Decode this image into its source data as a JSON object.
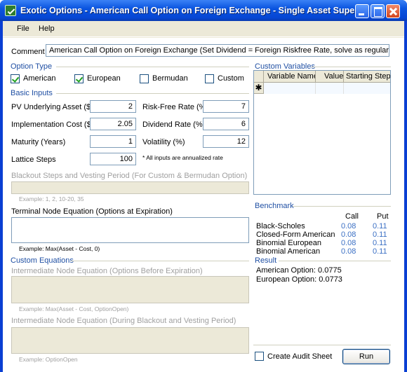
{
  "window": {
    "title": "Exotic Options - American Call Option on Foreign Exchange - Single Asset Super..."
  },
  "menu": {
    "file": "File",
    "help": "Help"
  },
  "comment": {
    "label": "Comment",
    "value": "American Call Option on Foreign Exchange (Set Dividend = Foreign Riskfree Rate, solve as regular options)"
  },
  "option_type": {
    "heading": "Option Type",
    "american": {
      "label": "American",
      "checked": true
    },
    "european": {
      "label": "European",
      "checked": true
    },
    "bermudan": {
      "label": "Bermudan",
      "checked": false
    },
    "custom": {
      "label": "Custom",
      "checked": false
    }
  },
  "basic_inputs": {
    "heading": "Basic Inputs",
    "pv_label": "PV Underlying Asset ($)",
    "pv_value": "2",
    "impl_label": "Implementation Cost ($)",
    "impl_value": "2.05",
    "maturity_label": "Maturity (Years)",
    "maturity_value": "1",
    "lattice_label": "Lattice Steps",
    "lattice_value": "100",
    "rf_label": "Risk-Free Rate (%)",
    "rf_value": "7",
    "div_label": "Dividend Rate (%)",
    "div_value": "6",
    "vol_label": "Volatility (%)",
    "vol_value": "12",
    "note": "* All inputs are annualized rate"
  },
  "blackout": {
    "label": "Blackout Steps and Vesting Period (For Custom & Bermudan Option)",
    "example": "Example: 1, 2, 10-20, 35"
  },
  "terminal": {
    "label": "Terminal Node Equation (Options at Expiration)",
    "example": "Example: Max(Asset - Cost, 0)"
  },
  "custom_equations": {
    "heading": "Custom Equations",
    "intermediate_label": "Intermediate Node Equation (Options Before Expiration)",
    "intermediate_example": "Example: Max(Asset - Cost, OptionOpen)",
    "blackout_label": "Intermediate Node Equation (During Blackout and Vesting Period)",
    "blackout_example": "Example: OptionOpen"
  },
  "custom_variables": {
    "heading": "Custom Variables",
    "columns": [
      "Variable Name",
      "Value",
      "Starting Step"
    ],
    "new_row_marker": "✱"
  },
  "benchmark": {
    "heading": "Benchmark",
    "call_header": "Call",
    "put_header": "Put",
    "rows": [
      {
        "name": "Black-Scholes",
        "call": "0.08",
        "put": "0.11"
      },
      {
        "name": "Closed-Form American",
        "call": "0.08",
        "put": "0.11"
      },
      {
        "name": "Binomial European",
        "call": "0.08",
        "put": "0.11"
      },
      {
        "name": "Binomial American",
        "call": "0.08",
        "put": "0.11"
      }
    ]
  },
  "result": {
    "heading": "Result",
    "american": "American Option: 0.0775",
    "european": "European Option: 0.0773"
  },
  "audit": {
    "label": "Create Audit Sheet",
    "checked": false
  },
  "run": {
    "label": "Run"
  }
}
